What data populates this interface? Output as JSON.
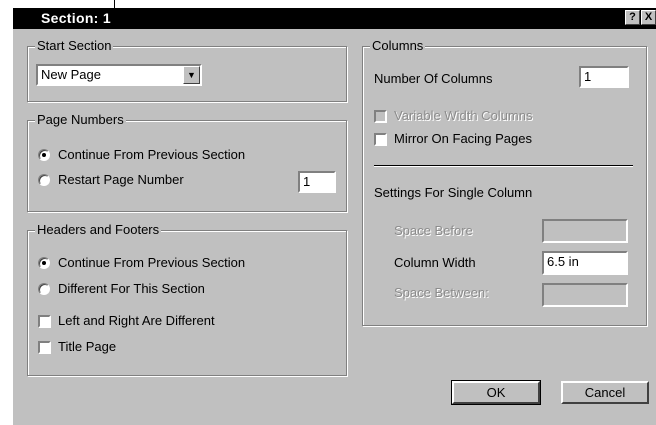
{
  "dialog": {
    "title": "Section: 1",
    "help_glyph": "?",
    "close_glyph": "X"
  },
  "start_section": {
    "legend": "Start Section",
    "value": "New Page",
    "dropdown_icon": "down-arrow"
  },
  "page_numbers": {
    "legend": "Page Numbers",
    "continue_label": "Continue From Previous Section",
    "restart_label": "Restart Page Number",
    "selected": "continue",
    "restart_number": "1"
  },
  "headers_footers": {
    "legend": "Headers and Footers",
    "continue_label": "Continue From Previous Section",
    "different_label": "Different For This Section",
    "selected": "continue",
    "left_right_label": "Left and Right Are Different",
    "left_right_checked": false,
    "title_page_label": "Title Page",
    "title_page_checked": false
  },
  "columns": {
    "legend": "Columns",
    "number_label": "Number Of Columns",
    "number_value": "1",
    "variable_width_label": "Variable Width Columns",
    "variable_width_checked": false,
    "mirror_label": "Mirror On Facing Pages",
    "mirror_checked": false,
    "single_settings_label": "Settings For Single Column",
    "space_before_label": "Space Before",
    "space_before_value": "",
    "column_width_label": "Column Width",
    "column_width_value": "6.5 in",
    "space_between_label": "Space Between:",
    "space_between_value": ""
  },
  "buttons": {
    "ok": "OK",
    "cancel": "Cancel"
  }
}
